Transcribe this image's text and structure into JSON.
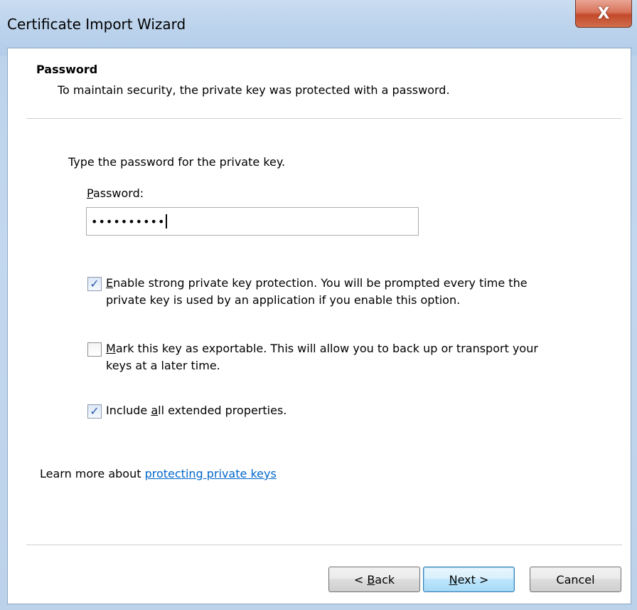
{
  "window": {
    "title": "Certificate Import Wizard",
    "close_symbol": "X"
  },
  "header": {
    "title": "Password",
    "description": "To maintain security, the private key was protected with a password."
  },
  "form": {
    "instruction": "Type the password for the private key.",
    "password_label_accel": "P",
    "password_label_rest": "assword:",
    "password_value": "••••••••••"
  },
  "options": [
    {
      "checked": true,
      "accel": "E",
      "line1_rest": "nable strong private key protection. You will be prompted every time the",
      "line2": "private key is used by an application if you enable this option."
    },
    {
      "checked": false,
      "accel": "M",
      "line1_rest": "ark this key as exportable. This will allow you to back up or transport your",
      "line2": "keys at a later time."
    },
    {
      "checked": true,
      "pre": "Include ",
      "accel": "a",
      "line1_rest": "ll extended properties."
    }
  ],
  "learn_more": {
    "prefix": "Learn more about ",
    "link": "protecting private keys"
  },
  "buttons": {
    "back_pre": "< ",
    "back_accel": "B",
    "back_rest": "ack",
    "next_accel": "N",
    "next_rest": "ext >",
    "cancel": "Cancel"
  },
  "checkmark_glyph": "✓"
}
